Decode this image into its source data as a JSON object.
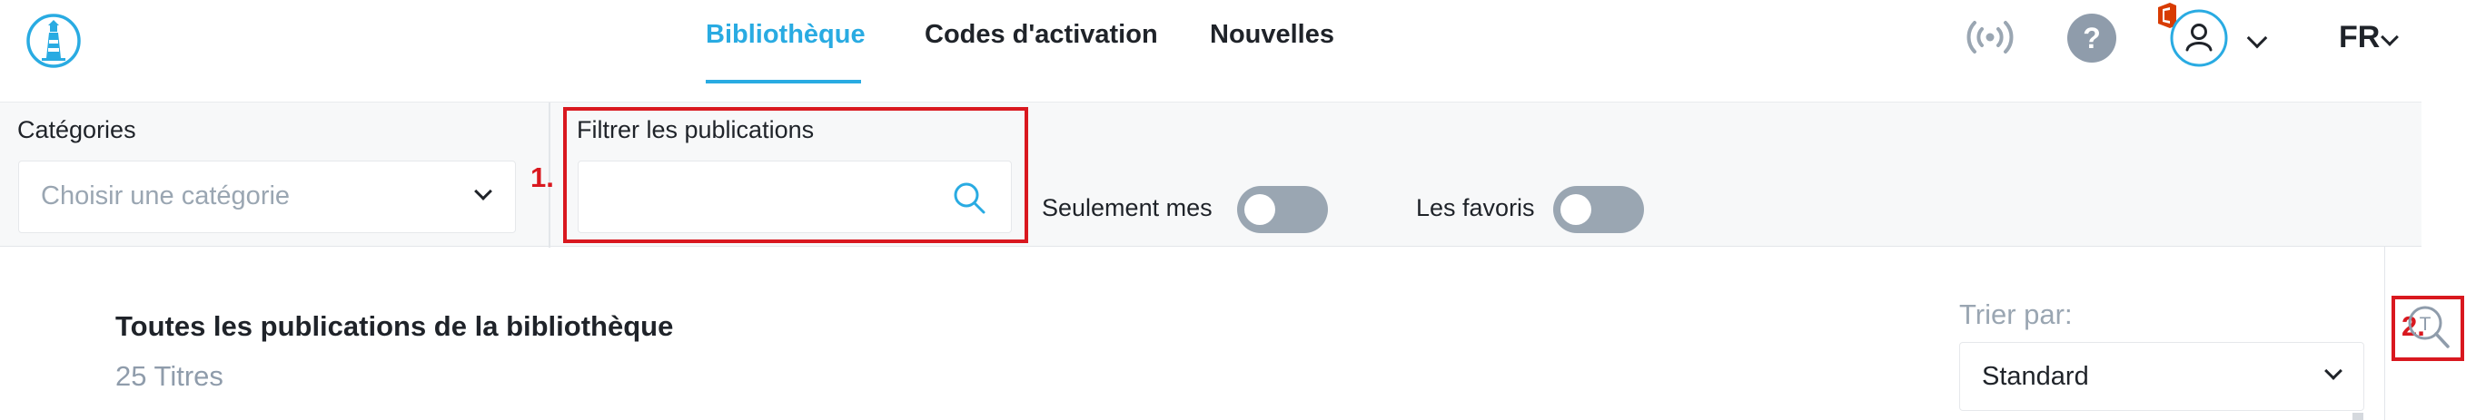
{
  "header": {
    "logo_icon": "lighthouse-icon",
    "nav": [
      {
        "label": "Bibliothèque",
        "active": true
      },
      {
        "label": "Codes d'activation",
        "active": false
      },
      {
        "label": "Nouvelles",
        "active": false
      }
    ],
    "icons": [
      "broadcast-icon",
      "help-icon",
      "office-icon",
      "user-icon",
      "chevron-down-icon"
    ],
    "language": "FR"
  },
  "filters": {
    "categories_label": "Catégories",
    "category_placeholder": "Choisir une catégorie",
    "filter_label": "Filtrer les publications",
    "filter_value": "",
    "only_mine_label": "Seulement mes",
    "only_mine_on": false,
    "favorites_label": "Les favoris",
    "favorites_on": false
  },
  "annotations": [
    "1.",
    "2."
  ],
  "content": {
    "title": "Toutes les publications de la bibliothèque",
    "count": "25 Titres",
    "sort_label": "Trier par:",
    "sort_value": "Standard"
  },
  "colors": {
    "accent": "#29abe2",
    "text": "#1f2329",
    "muted": "#9aa6b2",
    "toggle_off": "#9aa6b2",
    "annotation": "#d9181f",
    "office": "#d83b01"
  }
}
